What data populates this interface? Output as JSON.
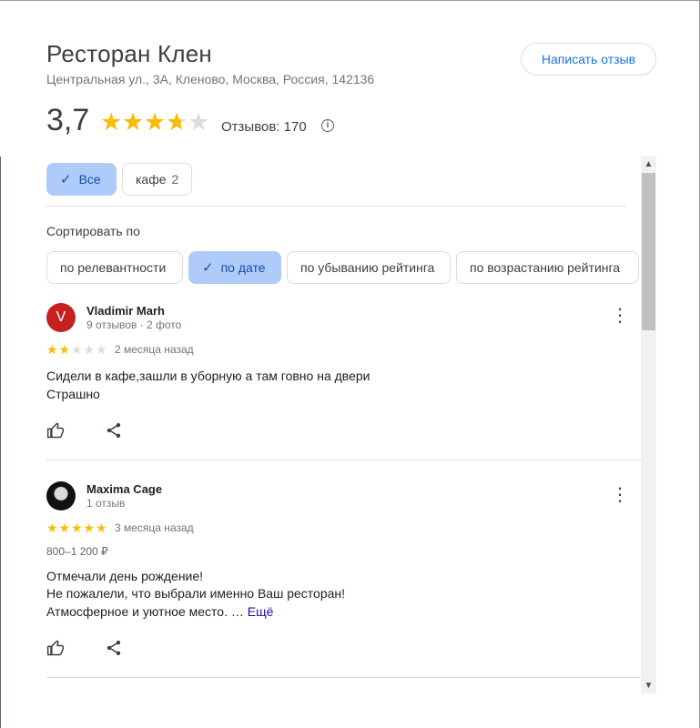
{
  "place": {
    "title": "Ресторан Клен",
    "address": "Центральная ул., 3А, Кленово, Москва, Россия, 142136",
    "write_review_label": "Написать отзыв",
    "rating": "3,7",
    "rating_value": 3.7,
    "review_count_label": "Отзывов: 170",
    "info_icon": "info-icon"
  },
  "filters": {
    "all_label": "Все",
    "cafe_label": "кафе",
    "cafe_count": "2"
  },
  "sort": {
    "label": "Сортировать по",
    "options": [
      "по релевантности",
      "по дате",
      "по убыванию рейтинга",
      "по возрастанию рейтинга"
    ],
    "selected": "по дате"
  },
  "reviews": [
    {
      "avatar_letter": "V",
      "avatar_color": "#c5221f",
      "name": "Vladimir Marh",
      "meta": "9 отзывов · 2 фото",
      "stars": 2,
      "when": "2 месяца назад",
      "lines": [
        "Сидели в кафе,зашли в уборную а там говно на двери",
        "Страшно"
      ]
    },
    {
      "avatar_letter": "",
      "name": "Maxima Cage",
      "meta": "1 отзыв",
      "stars": 5,
      "when": "3 месяца назад",
      "price": "800–1 200 ₽",
      "lines": [
        "Отмечали день рождение!",
        "Не пожалели, что выбрали именно Ваш ресторан!",
        "Атмосферное и уютное место. …"
      ],
      "more_label": "Ещё"
    }
  ],
  "colors": {
    "accent": "#1a73e8",
    "chip_active": "#aecbfa",
    "star": "#fbbc04",
    "star_empty": "#dadce0"
  }
}
